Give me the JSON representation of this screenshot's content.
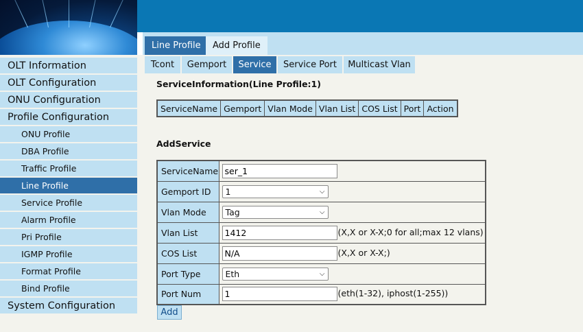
{
  "nav": {
    "items": [
      {
        "label": "OLT Information",
        "level": "top",
        "active": false
      },
      {
        "label": "OLT Configuration",
        "level": "top",
        "active": false
      },
      {
        "label": "ONU Configuration",
        "level": "top",
        "active": false
      },
      {
        "label": "Profile Configuration",
        "level": "top",
        "active": false
      },
      {
        "label": "ONU Profile",
        "level": "sub",
        "active": false
      },
      {
        "label": "DBA Profile",
        "level": "sub",
        "active": false
      },
      {
        "label": "Traffic Profile",
        "level": "sub",
        "active": false
      },
      {
        "label": "Line Profile",
        "level": "sub",
        "active": true
      },
      {
        "label": "Service Profile",
        "level": "sub",
        "active": false
      },
      {
        "label": "Alarm Profile",
        "level": "sub",
        "active": false
      },
      {
        "label": "Pri Profile",
        "level": "sub",
        "active": false
      },
      {
        "label": "IGMP Profile",
        "level": "sub",
        "active": false
      },
      {
        "label": "Format Profile",
        "level": "sub",
        "active": false
      },
      {
        "label": "Bind Profile",
        "level": "sub",
        "active": false
      },
      {
        "label": "System Configuration",
        "level": "top",
        "active": false
      }
    ]
  },
  "top_tabs": [
    "Line Profile",
    "Add Profile"
  ],
  "sub_tabs": [
    "Tcont",
    "Gemport",
    "Service",
    "Service Port",
    "Multicast Vlan"
  ],
  "service_info": {
    "title": "ServiceInformation(Line Profile:1)",
    "columns": [
      "ServiceName",
      "Gemport",
      "Vlan Mode",
      "Vlan List",
      "COS List",
      "Port",
      "Action"
    ]
  },
  "add_service": {
    "title": "AddService",
    "service_name": {
      "label": "ServiceName",
      "value": "ser_1"
    },
    "gemport_id": {
      "label": "Gemport ID",
      "value": "1"
    },
    "vlan_mode": {
      "label": "Vlan Mode",
      "value": "Tag"
    },
    "vlan_list": {
      "label": "Vlan List",
      "value": "1412",
      "hint": "(X,X or X-X;0 for all;max 12 vlans)"
    },
    "cos_list": {
      "label": "COS List",
      "value": "N/A",
      "hint": "(X,X or X-X;)"
    },
    "port_type": {
      "label": "Port Type",
      "value": "Eth"
    },
    "port_num": {
      "label": "Port Num",
      "value": "1",
      "hint": "(eth(1-32), iphost(1-255))"
    },
    "add_label": "Add"
  },
  "colors": {
    "header_blue": "#0a77b4",
    "light_blue": "#bfe0f2",
    "active_blue": "#2f6fa8",
    "panel_bg": "#f3f3ed"
  }
}
